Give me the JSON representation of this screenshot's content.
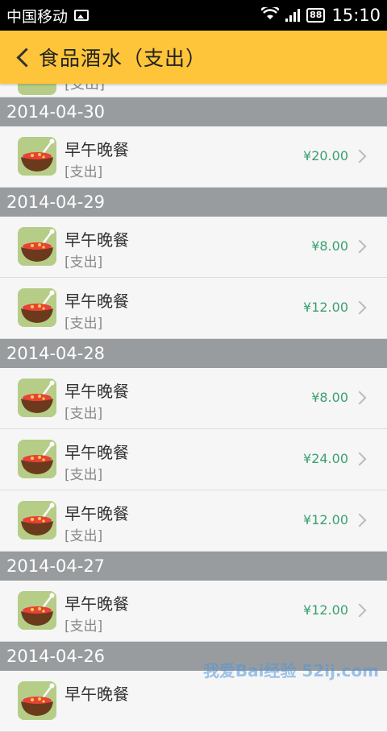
{
  "status_bar": {
    "carrier": "中国移动",
    "battery": "88",
    "time": "15:10"
  },
  "header": {
    "title": "食品酒水（支出）"
  },
  "partial_item": {
    "category": "[支出]"
  },
  "groups": [
    {
      "date": "2014-04-30",
      "items": [
        {
          "name": "早午晚餐",
          "category": "[支出]",
          "amount": "¥20.00"
        }
      ]
    },
    {
      "date": "2014-04-29",
      "items": [
        {
          "name": "早午晚餐",
          "category": "[支出]",
          "amount": "¥8.00"
        },
        {
          "name": "早午晚餐",
          "category": "[支出]",
          "amount": "¥12.00"
        }
      ]
    },
    {
      "date": "2014-04-28",
      "items": [
        {
          "name": "早午晚餐",
          "category": "[支出]",
          "amount": "¥8.00"
        },
        {
          "name": "早午晚餐",
          "category": "[支出]",
          "amount": "¥24.00"
        },
        {
          "name": "早午晚餐",
          "category": "[支出]",
          "amount": "¥12.00"
        }
      ]
    },
    {
      "date": "2014-04-27",
      "items": [
        {
          "name": "早午晚餐",
          "category": "[支出]",
          "amount": "¥12.00"
        }
      ]
    },
    {
      "date": "2014-04-26",
      "items": [
        {
          "name": "早午晚餐",
          "category": "",
          "amount": ""
        }
      ]
    }
  ],
  "watermark": "我爱Bai经验 52ij.com",
  "colors": {
    "header_bg": "#ffc53a",
    "date_header_bg": "#999c9e",
    "amount": "#3aa070"
  },
  "icons": {
    "back": "chevron-left-icon",
    "thumbnail": "food-bowl-icon",
    "row_arrow": "chevron-right-icon"
  }
}
